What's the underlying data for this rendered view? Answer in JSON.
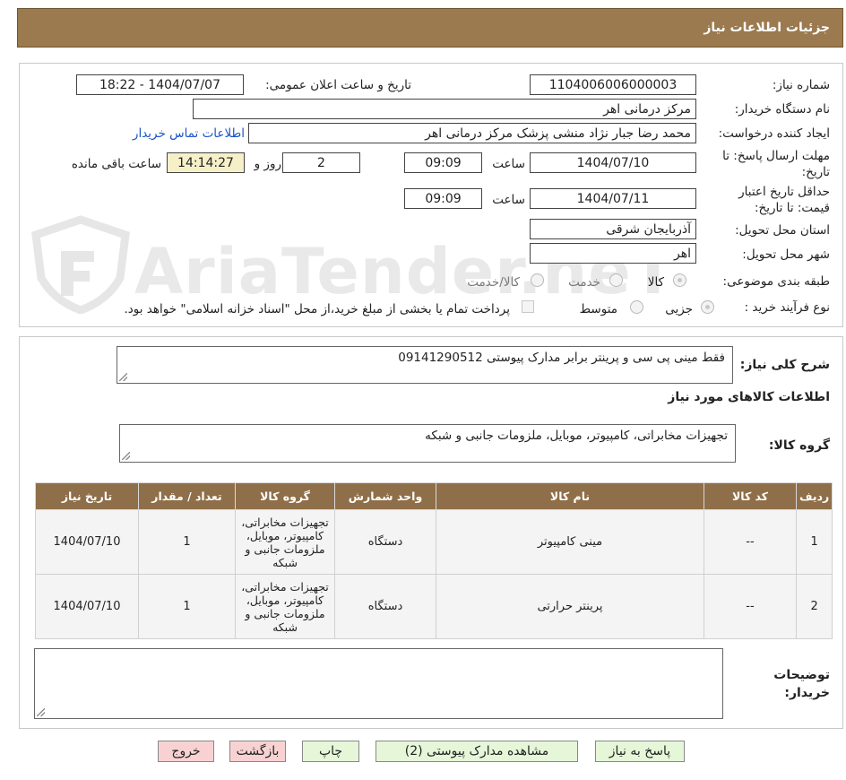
{
  "header": {
    "title": "جزئيات اطلاعات نياز"
  },
  "watermark": {
    "text": "AriaTender.neT"
  },
  "form": {
    "need_number_label": "شماره نیاز:",
    "need_number": "1104006006000003",
    "announce_label": "تاریخ و ساعت اعلان عمومی:",
    "announce_value": "1404/07/07 - 18:22",
    "buyer_org_label": "نام دستگاه خریدار:",
    "buyer_org": "مرکز درمانی اهر",
    "creator_label": "ایجاد کننده درخواست:",
    "creator": "محمد رضا  جبار نژاد منشی پزشک  مرکز درمانی اهر",
    "contact_link": "اطلاعات تماس خریدار",
    "deadline_label_1": "مهلت ارسال پاسخ: تا",
    "deadline_label_2": "تاریخ:",
    "deadline_date": "1404/07/10",
    "time_label": "ساعت",
    "deadline_time": "09:09",
    "days_value": "2",
    "days_label": "روز و",
    "remaining_time": "14:14:27",
    "remaining_label": "ساعت باقی مانده",
    "validity_label_1": "حداقل تاریخ اعتبار",
    "validity_label_2": "قیمت: تا تاریخ:",
    "validity_date": "1404/07/11",
    "validity_time": "09:09",
    "province_label": "استان محل تحویل:",
    "province": "آذربایجان شرقی",
    "city_label": "شهر محل تحویل:",
    "city": "اهر",
    "category_label": "طبقه بندی موضوعی:",
    "category_options": [
      "کالا",
      "خدمت",
      "کالا/خدمت"
    ],
    "category_selected": "کالا",
    "process_label": "نوع فرآیند خرید :",
    "process_options": [
      "جزیی",
      "متوسط"
    ],
    "process_selected": "جزیی",
    "treasury_note": "پرداخت تمام یا بخشی از مبلغ خرید،از محل \"اسناد خزانه اسلامی\" خواهد بود."
  },
  "description": {
    "label": "شرح کلی نیاز:",
    "text": "فقط مینی پی سی و پرینتر برابر مدارک پیوستی 09141290512"
  },
  "goods_section": {
    "title": "اطلاعات کالاهای مورد نیاز",
    "group_label": "گروه کالا:",
    "group_value": "تجهیزات مخابراتی، کامپیوتر، موبایل، ملزومات جانبی و شبکه"
  },
  "table": {
    "headers": [
      "ردیف",
      "کد کالا",
      "نام کالا",
      "واحد شمارش",
      "گروه کالا",
      "تعداد / مقدار",
      "تاریخ نیاز"
    ],
    "rows": [
      {
        "row": "1",
        "code": "--",
        "name": "مینی کامپیوتر",
        "unit": "دستگاه",
        "group": "تجهیزات مخابراتی، کامپیوتر، موبایل، ملزومات جانبی و شبکه",
        "qty": "1",
        "date": "1404/07/10"
      },
      {
        "row": "2",
        "code": "--",
        "name": "پرینتر حرارتی",
        "unit": "دستگاه",
        "group": "تجهیزات مخابراتی، کامپیوتر، موبایل، ملزومات جانبی و شبکه",
        "qty": "1",
        "date": "1404/07/10"
      }
    ]
  },
  "buyer_notes": {
    "label_1": "توضیحات",
    "label_2": "خریدار:",
    "text": ""
  },
  "buttons": {
    "reply": "پاسخ به نیاز",
    "attachments": "مشاهده مدارک پیوستی (2)",
    "print": "چاپ",
    "back": "بازگشت",
    "exit": "خروج"
  },
  "colors": {
    "header_bg": "#9c7a4f",
    "table_header_bg": "#8f6f49",
    "button_green": "#e6f6d8",
    "button_pink": "#f8d2d2",
    "remaining_bg": "#f5f0c8",
    "link": "#1a55c8"
  }
}
